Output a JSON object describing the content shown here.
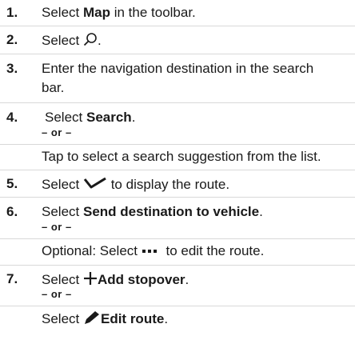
{
  "steps": [
    {
      "num": "1.",
      "pre": "Select ",
      "bold": "Map",
      "post": " in the toolbar."
    },
    {
      "num": "2.",
      "pre": "Select ",
      "icon": "search-icon",
      "post": "."
    },
    {
      "num": "3.",
      "line1": "Enter the navigation destination in the search",
      "line2": "bar."
    },
    {
      "num": "4.",
      "pre": "Select ",
      "bold": "Search",
      "post": ".",
      "or": "– or –",
      "alt": "Tap to select a search suggestion from the list."
    },
    {
      "num": "5.",
      "pre": "Select ",
      "icon": "chevron-down-icon",
      "post": " to display the route."
    },
    {
      "num": "6.",
      "pre": "Select ",
      "bold": "Send destination to vehicle",
      "post": ".",
      "or": "– or –",
      "alt_pre": "Optional: Select ",
      "alt_icon": "more-icon",
      "alt_post": " to edit the route."
    },
    {
      "num": "7.",
      "pre": "Select ",
      "icon": "plus-icon",
      "bold": "Add stopover",
      "post": ".",
      "or": "– or –",
      "alt_pre": "Select ",
      "alt_icon": "pencil-icon",
      "alt_bold": "Edit route",
      "alt_post": "."
    }
  ]
}
